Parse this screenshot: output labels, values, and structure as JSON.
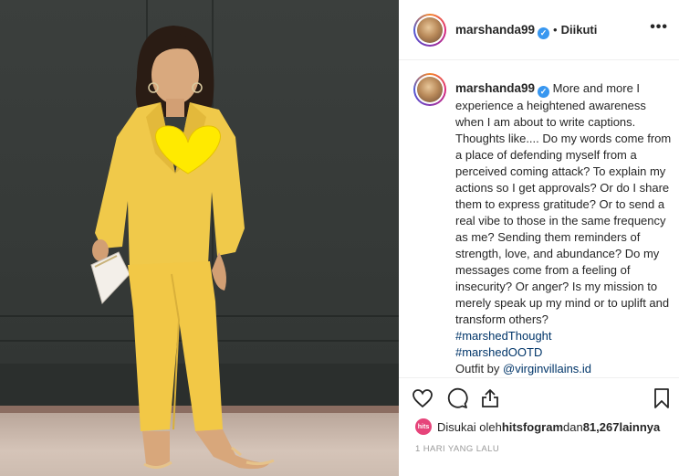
{
  "post": {
    "username": "marshanda99",
    "verified_mark": "✓",
    "separator": "•",
    "follow_state": "Diikuti",
    "more_label": "•••"
  },
  "caption": {
    "username": "marshanda99",
    "text": "More and more I experience a heightened awareness when I am about to write captions. Thoughts like.... Do my words come from a place of defending myself from a perceived coming attack? To explain my actions so I get approvals? Or do I share them to express gratitude? Or to send a real vibe to those in the same frequency as me? Sending them reminders of strength, love, and abundance? Do my messages come from a feeling of insecurity? Or anger? Is my mission to merely speak up my mind or to uplift and transform others?",
    "hashtags": [
      "#marshedThought",
      "#marshedOOTD"
    ],
    "outfit_prefix": "Outfit by ",
    "outfit_mention": "@virginvillains.id"
  },
  "actions": {
    "icons": [
      "heart-icon",
      "comment-icon",
      "share-icon",
      "bookmark-icon"
    ]
  },
  "likes": {
    "liker_avatar_text": "hits",
    "prefix": "Disukai oleh ",
    "liker": "hitsfogram",
    "middle": " dan ",
    "count": "81,267",
    "suffix": " lainnya"
  },
  "timestamp": "1 HARI YANG LALU",
  "colors": {
    "link": "#003569",
    "verified": "#3897f0",
    "suit": "#f0c94a",
    "heart_sticker": "#ffea00"
  }
}
